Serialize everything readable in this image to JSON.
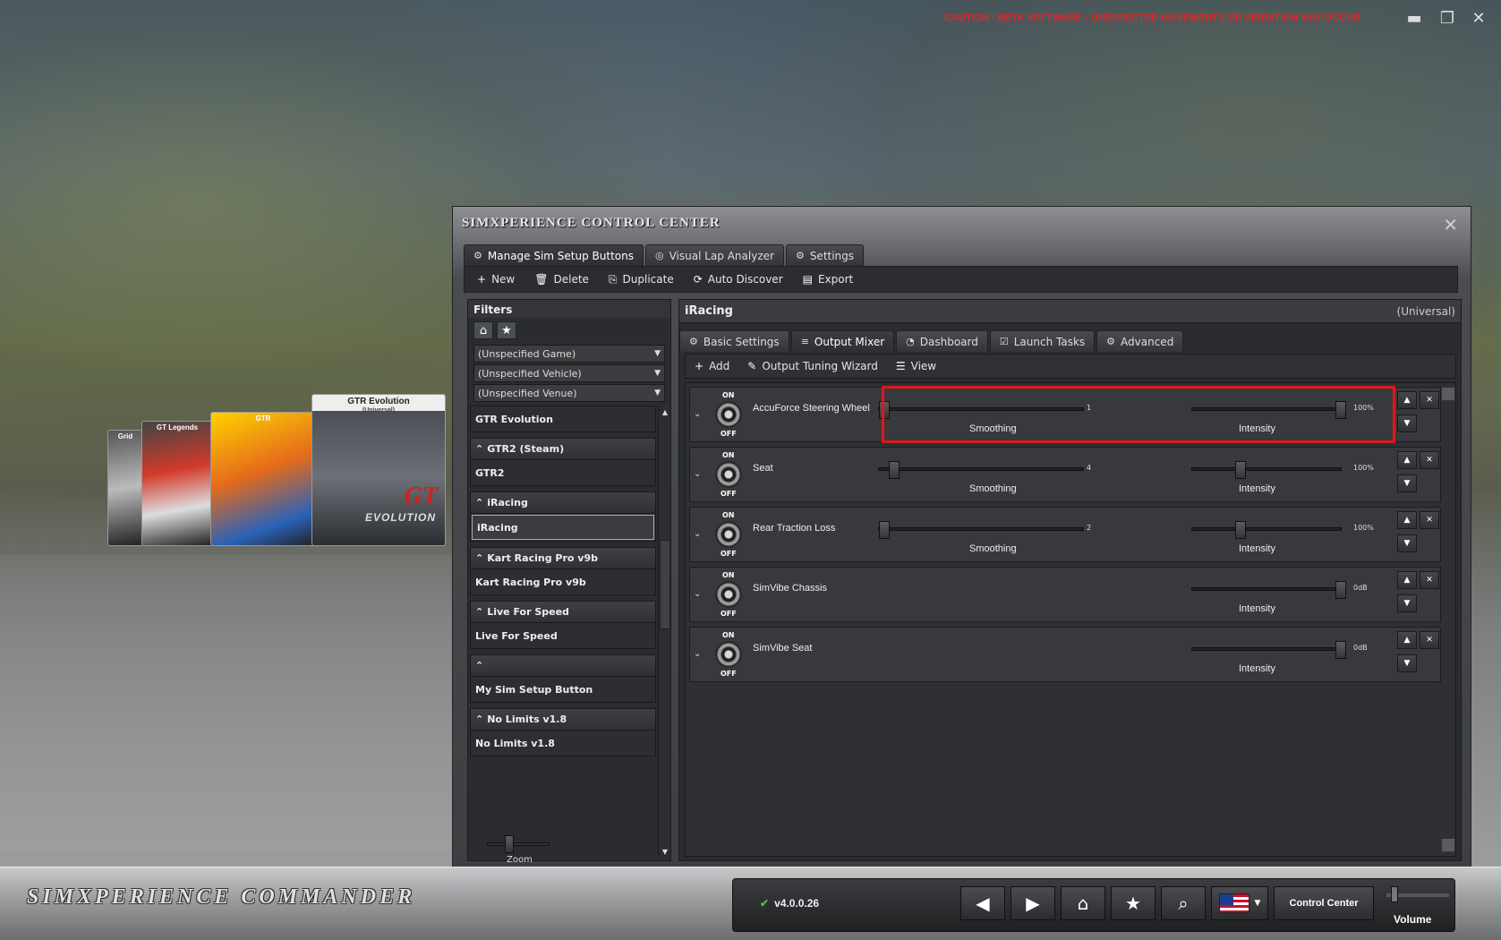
{
  "caution_text": "CAUTION - BETA SOFTWARE - UNEXPECTED MOVEMENTS OR VIBRATION MAY OCCUR",
  "window_controls": {
    "minimize": "▬",
    "maximize": "❐",
    "close": "✕"
  },
  "covers": {
    "main": {
      "title": "GTR Evolution",
      "subtitle": "(Universal)",
      "logo": "GT",
      "logo_sub": "EVOLUTION"
    },
    "c1": {
      "title": "GTR"
    },
    "c2": {
      "title": "GT Legends"
    },
    "c3": {
      "title": "Grid"
    }
  },
  "panel": {
    "title": "SIMXPERIENCE CONTROL CENTER",
    "tabs": [
      {
        "label": "Manage Sim Setup Buttons",
        "icon": "⚙"
      },
      {
        "label": "Visual Lap Analyzer",
        "icon": "◎"
      },
      {
        "label": "Settings",
        "icon": "⚙"
      }
    ],
    "toolbar": [
      {
        "label": "New",
        "icon": "+"
      },
      {
        "label": "Delete",
        "icon": "🗑"
      },
      {
        "label": "Duplicate",
        "icon": "⎘"
      },
      {
        "label": "Auto Discover",
        "icon": "⟳"
      },
      {
        "label": "Export",
        "icon": "▤"
      }
    ]
  },
  "filters": {
    "title": "Filters",
    "selects": [
      "(Unspecified Game)",
      "(Unspecified Vehicle)",
      "(Unspecified Venue)"
    ],
    "groups": [
      {
        "header": "GTR Evolution",
        "items": []
      },
      {
        "header": "GTR2 (Steam)",
        "items": [
          "GTR2"
        ]
      },
      {
        "header": "iRacing",
        "items": [
          "iRacing"
        ]
      },
      {
        "header": "Kart Racing Pro v9b",
        "items": [
          "Kart Racing Pro v9b"
        ]
      },
      {
        "header": "Live For Speed",
        "items": [
          "Live For Speed"
        ]
      },
      {
        "header": "",
        "items": [
          "My Sim Setup Button"
        ]
      },
      {
        "header": "No Limits v1.8",
        "items": [
          "No Limits v1.8"
        ]
      }
    ]
  },
  "zoom_label": "Zoom",
  "right": {
    "title": "iRacing",
    "subtitle": "(Universal)",
    "tabs": [
      {
        "label": "Basic Settings",
        "icon": "⚙"
      },
      {
        "label": "Output Mixer",
        "icon": "≡"
      },
      {
        "label": "Dashboard",
        "icon": "◔"
      },
      {
        "label": "Launch Tasks",
        "icon": "☑"
      },
      {
        "label": "Advanced",
        "icon": "⚙"
      }
    ],
    "toolbar": [
      {
        "label": "Add",
        "icon": "+"
      },
      {
        "label": "Output Tuning Wizard",
        "icon": "✎"
      },
      {
        "label": "View",
        "icon": "☰"
      }
    ]
  },
  "mixer": {
    "on_label": "ON",
    "off_label": "OFF",
    "rows": [
      {
        "name": "AccuForce Steering Wheel",
        "smoothing": "1",
        "intensity": "100%",
        "has_smoothing": true,
        "smooth_level": 0.0,
        "intensity_level": 1.0
      },
      {
        "name": "Seat",
        "smoothing": "4",
        "intensity": "100%",
        "has_smoothing": true,
        "smooth_level": 0.05,
        "intensity_level": 0.3
      },
      {
        "name": "Rear Traction Loss",
        "smoothing": "2",
        "intensity": "100%",
        "has_smoothing": true,
        "smooth_level": 0.0,
        "intensity_level": 0.3
      },
      {
        "name": "SimVibe Chassis",
        "smoothing": "",
        "intensity": "0dB",
        "has_smoothing": false,
        "smooth_level": 0,
        "intensity_level": 1.0
      },
      {
        "name": "SimVibe Seat",
        "smoothing": "",
        "intensity": "0dB",
        "has_smoothing": false,
        "smooth_level": 0,
        "intensity_level": 1.0
      }
    ],
    "smoothing_label": "Smoothing",
    "intensity_label": "Intensity"
  },
  "bottom": {
    "brand": "SIMXPERIENCE COMMANDER",
    "version": "v4.0.0.26",
    "control_center": "Control Center",
    "volume": "Volume",
    "volume_level": 0.05
  },
  "colors": {
    "caution": "#e62424",
    "highlight": "#e0161b",
    "check": "#4cc13b"
  }
}
